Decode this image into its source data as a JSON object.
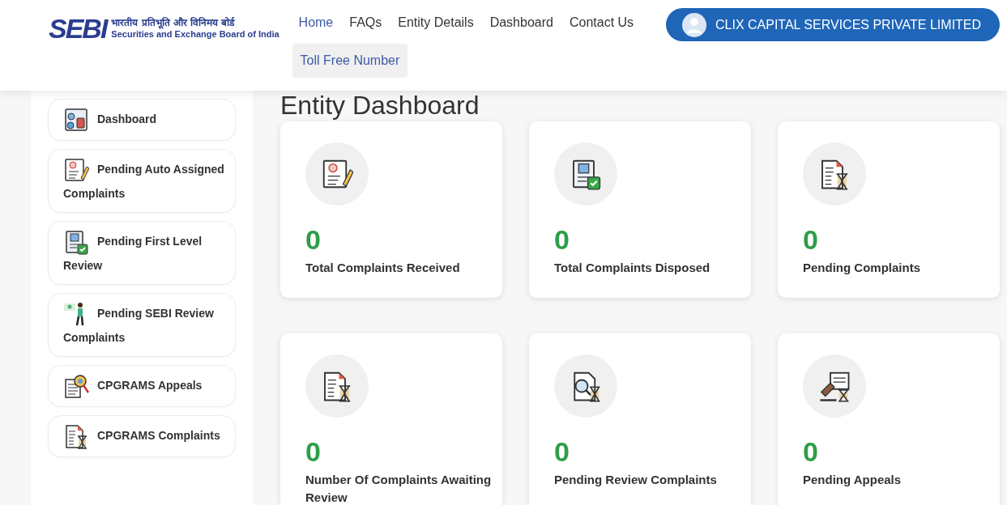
{
  "header": {
    "logo": {
      "mark": "SEBI",
      "hindi": "भारतीय प्रतिभूति और विनिमय बोर्ड",
      "english": "Securities and Exchange Board of India"
    },
    "nav": [
      {
        "label": "Home",
        "selected": true
      },
      {
        "label": "FAQs",
        "selected": false
      },
      {
        "label": "Entity Details",
        "selected": false
      },
      {
        "label": "Dashboard",
        "selected": false
      },
      {
        "label": "Contact Us",
        "selected": false
      }
    ],
    "toll_free": "Toll Free Number",
    "user": "CLIX CAPITAL SERVICES PRIVATE LIMITED"
  },
  "sidebar": {
    "items": [
      {
        "label": "Dashboard",
        "kind": "dashboard"
      },
      {
        "label": "Pending Auto Assigned Complaints",
        "kind": "pen"
      },
      {
        "label": "Pending First Level Review",
        "kind": "check"
      },
      {
        "label": "Pending SEBI Review Complaints",
        "kind": "person"
      },
      {
        "label": "CPGRAMS Appeals",
        "kind": "magnifier"
      },
      {
        "label": "CPGRAMS Complaints",
        "kind": "hourglass"
      }
    ]
  },
  "main": {
    "title": "Entity Dashboard",
    "cards": [
      {
        "value": "0",
        "label": "Total Complaints Received",
        "kind": "pen"
      },
      {
        "value": "0",
        "label": "Total Complaints Disposed",
        "kind": "check"
      },
      {
        "value": "0",
        "label": "Pending Complaints",
        "kind": "hourglass"
      },
      {
        "value": "0",
        "label": "Number Of Complaints Awaiting Review",
        "kind": "hourglass"
      },
      {
        "value": "0",
        "label": "Pending Review Complaints",
        "kind": "search"
      },
      {
        "value": "0",
        "label": "Pending Appeals",
        "kind": "gavel"
      }
    ]
  }
}
